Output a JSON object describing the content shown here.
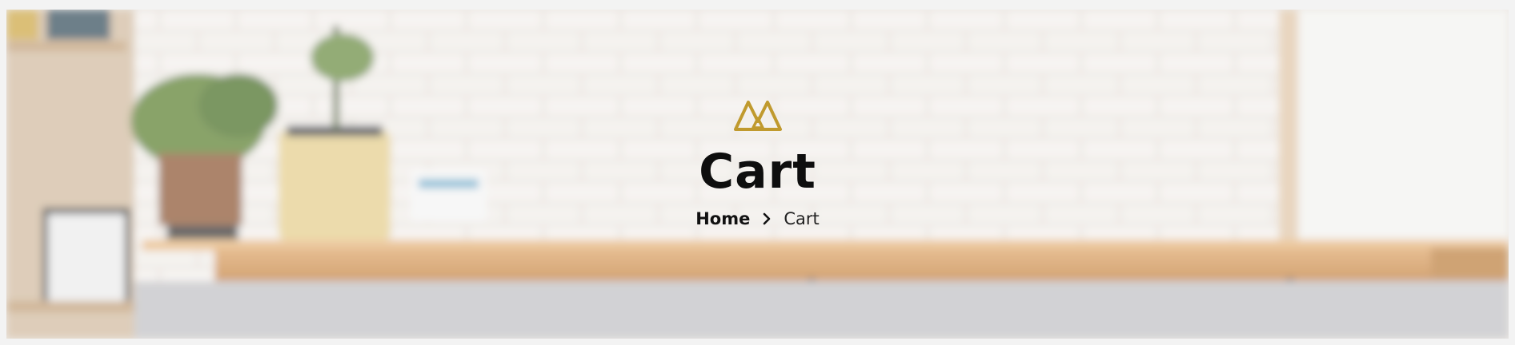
{
  "hero": {
    "title": "Cart",
    "breadcrumb": {
      "home_label": "Home",
      "separator_icon": "chevron-right-icon",
      "current_label": "Cart"
    },
    "logo_icon": "double-triangle-logo-icon"
  },
  "colors": {
    "logo_gold": "#c09a2e",
    "title_text": "#0e0e0e",
    "counter_wood": "#d9a36b"
  }
}
